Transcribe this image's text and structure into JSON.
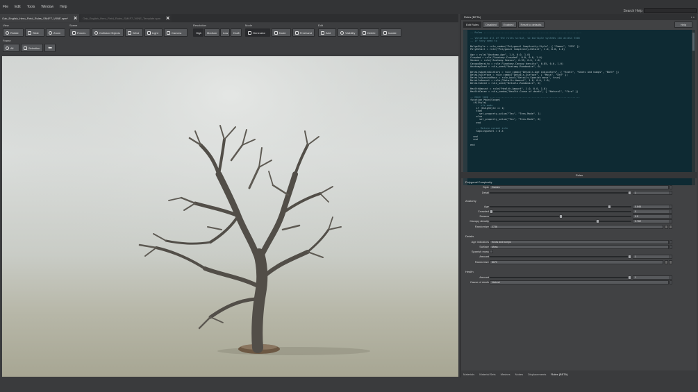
{
  "menu": [
    "File",
    "Edit",
    "Tools",
    "Window",
    "Help"
  ],
  "search": {
    "label": "Search Help",
    "placeholder": ""
  },
  "doc_tabs": [
    {
      "label": "Oak_English_Hero_Field_Rules_SM4F7_V0NE.spm*",
      "active": true
    },
    {
      "label": "Oak_English_Hero_Field_Rules_SM4F7_V0NE_Template.spm",
      "active": false
    }
  ],
  "toolbar": {
    "view": {
      "label": "View",
      "buttons": [
        "Rotate",
        "Slide",
        "Zoom"
      ]
    },
    "scene": {
      "label": "Scene",
      "buttons": [
        "Forces",
        "Collision Objects",
        "Wind",
        "Light",
        "Camera"
      ]
    },
    "resolution": {
      "label": "Resolution",
      "buttons": [
        "High",
        "Medium",
        "Low",
        "Draft"
      ]
    },
    "mode": {
      "label": "Mode",
      "buttons": [
        "Generator",
        "Node",
        "Freehand"
      ]
    },
    "edit": {
      "label": "Edit",
      "buttons": [
        "Add",
        "Visibility",
        "Delete",
        "Isolate"
      ]
    },
    "frame": {
      "label": "Frame",
      "buttons": [
        "All",
        "Selection"
      ]
    }
  },
  "panel": {
    "title": "Rules (BETA)",
    "tabs": [
      "Edit Rules",
      "Disabled",
      "Enabled",
      "Reset to defaults"
    ],
    "help": "Help",
    "header": "Rules"
  },
  "code_lines": [
    "-- Rules -----------------------------------------------------------------",
    "",
    "-- Variation all of the rules script, so multiple systems can access them",
    "-- if they need to",
    "",
    "BulgeStyle = rule_combo(\"Polygonal Complexity.Style\", { \"Games\", \"VFX\" })",
    "PolyDetail = rule(\"Polygonal Complexity.Detail\", 1.0, 0.0, 1.0)",
    "",
    "Age = rule(\"Anatomy.Age\", 1.0, 0.0, 1.0)",
    "Crowded = rule(\"Anatomy.Crowded\", 0.0, 0.0, 1.0)",
    "Season = rule(\"Anatomy.Season\", 0.35, 0.0, 1.0)",
    "CanopyDensity = rule(\"Anatomy.Canopy density\", 0.85, 0.0, 1.0)",
    "AnatomySeed = rule_seed(\"Anatomy.Randomize\", 0)",
    "",
    "DetailsAgeIndicators = rule_combo(\"Details.Age indicators\", { \"Knots\", \"Knots and bumps\", \"Both\" })",
    "DetailsSurface = rule_combo(\"Details.Surface\", { \"Moss\", \"Dry\" })",
    "DetailsSpanishMoss = rule_bool(\"Details.Spanish moss\", true)",
    "DetailsAmount = rule(\"Details.Amount\", 1.0, 0.0, 1.0)",
    "DetailsSeed = rule_seed(\"Details.Randomize\", 0)",
    "",
    "HealthAmount = rule(\"Health.Amount\", 1.0, 0.0, 1.0)",
    "HealthCause = rule_combo(\"Health.Cause of death\", { \"Natural\", \"Fire\" })",
    "",
    "-- main loop ------------------------------------------------------------",
    "function Main(Scope)",
    "  if(Style)",
    "    -- vfx mode",
    "    if (BulgStyle == 1)",
    "    then",
    "      set_property_value(\"Tex\", \"Tess.Mode\", 1)",
    "    else",
    "      set_property_value(\"Tex\", \"Tess.Mode\", 0)",
    "    end",
    "",
    "    -- Mature normal info",
    "    SaplingLevel = 0.3",
    "",
    "  end",
    "  end",
    "",
    "end"
  ],
  "sections": {
    "poly": {
      "title": "Polygonal Complexity",
      "style": {
        "label": "Style",
        "value": "Games"
      },
      "detail": {
        "label": "Detail",
        "value": "1"
      }
    },
    "anatomy": {
      "title": "Anatomy",
      "age": {
        "label": "Age",
        "value": "0.846"
      },
      "crowded": {
        "label": "Crowded",
        "value": "0"
      },
      "season": {
        "label": "Season",
        "value": "0.5"
      },
      "canopy": {
        "label": "Canopy density",
        "value": "0.762"
      },
      "randomize": {
        "label": "Randomize",
        "value": "2736"
      }
    },
    "details": {
      "title": "Details",
      "age_ind": {
        "label": "Age indicators",
        "value": "Knots and bumps"
      },
      "surface": {
        "label": "Surface",
        "value": "Moss"
      },
      "spanish": {
        "label": "Spanish moss"
      },
      "amount": {
        "label": "Amount",
        "value": "1"
      },
      "randomize": {
        "label": "Randomize",
        "value": "8670"
      }
    },
    "health": {
      "title": "Health",
      "amount": {
        "label": "Amount",
        "value": "1"
      },
      "cause": {
        "label": "Cause of death",
        "value": "Natural"
      }
    }
  },
  "bottom_tabs": [
    "Materials",
    "Material Sets",
    "Meshes",
    "Nodes",
    "Displacements",
    "Rules (BETA)"
  ]
}
